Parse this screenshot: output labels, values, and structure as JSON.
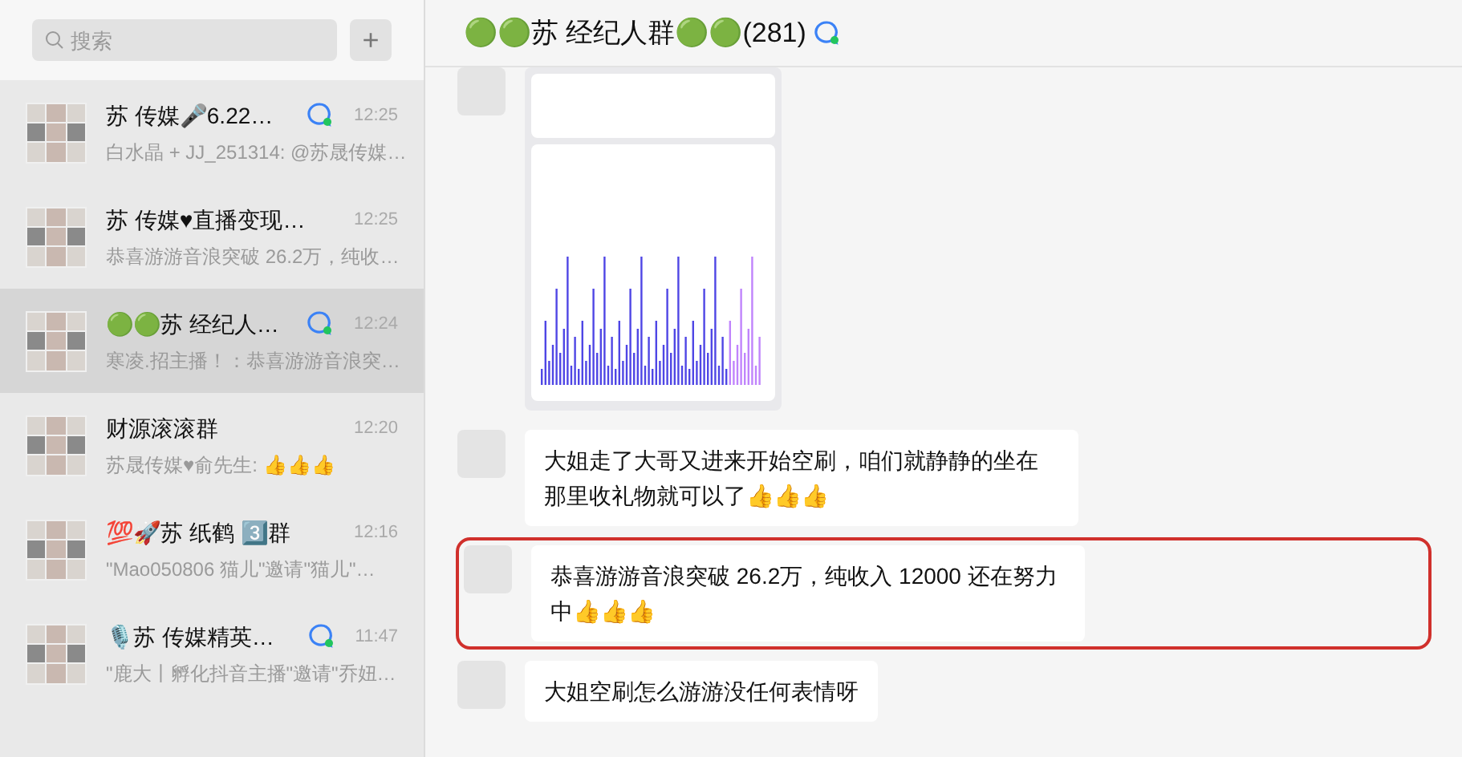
{
  "search": {
    "placeholder": "搜索"
  },
  "add_button": {
    "label": "+"
  },
  "chats": [
    {
      "name": "苏 传媒🎤6.22…",
      "preview": "白水晶 + JJ_251314: @苏晟传媒…",
      "time": "12:25",
      "mention": true,
      "selected": false
    },
    {
      "name": "苏 传媒♥直播变现…",
      "preview": "恭喜游游音浪突破 26.2万，纯收…",
      "time": "12:25",
      "mention": false,
      "selected": false
    },
    {
      "name": "🟢🟢苏 经纪人…",
      "preview": "寒凌.招主播！：恭喜游游音浪突…",
      "time": "12:24",
      "mention": true,
      "selected": true
    },
    {
      "name": "财源滚滚群",
      "preview": "苏晟传媒♥俞先生: 👍👍👍",
      "time": "12:20",
      "mention": false,
      "selected": false
    },
    {
      "name": "💯🚀苏  纸鹤 3️⃣群",
      "preview": "\"Mao050806  猫儿\"邀请\"猫儿\"…",
      "time": "12:16",
      "mention": false,
      "selected": false
    },
    {
      "name": "🎙️苏 传媒精英…",
      "preview": "\"鹿大丨孵化抖音主播\"邀请\"乔妞…",
      "time": "11:47",
      "mention": true,
      "selected": false
    }
  ],
  "chat": {
    "title": "🟢🟢苏 经纪人群🟢🟢(281)",
    "messages": [
      {
        "kind": "image",
        "highlighted": false
      },
      {
        "kind": "text",
        "text": "大姐走了大哥又进来开始空刷，咱们就静静的坐在那里收礼物就可以了👍👍👍",
        "highlighted": false
      },
      {
        "kind": "text",
        "text": "恭喜游游音浪突破 26.2万，纯收入 12000 还在努力中👍👍👍",
        "highlighted": true
      },
      {
        "kind": "text",
        "text": "大姐空刷怎么游游没任何表情呀",
        "highlighted": false
      }
    ]
  }
}
